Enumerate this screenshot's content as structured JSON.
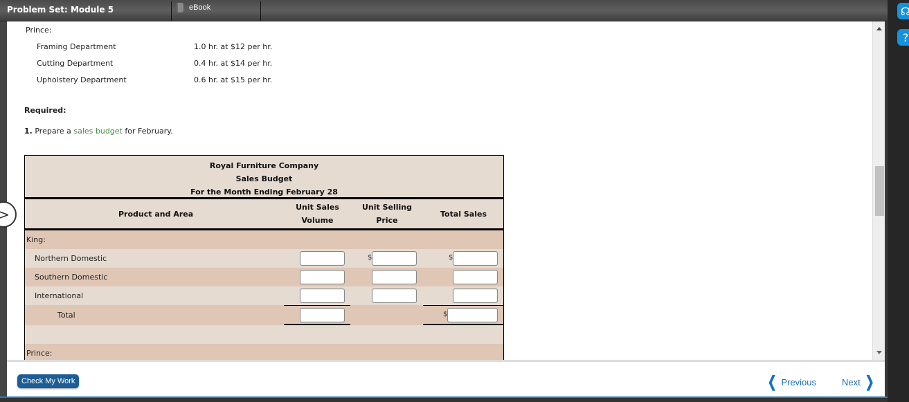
{
  "window": {
    "title": "Problem Set: Module 5",
    "tabs": [
      {
        "label": "eBook",
        "icon": "book-icon"
      }
    ]
  },
  "problem": {
    "prince_label": "Prince:",
    "departments": [
      {
        "name": "Framing Department",
        "rate": "1.0 hr. at $12 per hr."
      },
      {
        "name": "Cutting Department",
        "rate": "0.4 hr. at $14 per hr."
      },
      {
        "name": "Upholstery Department",
        "rate": "0.6 hr. at $15 per hr."
      }
    ],
    "required_label": "Required:",
    "instruction": {
      "number": "1.",
      "prefix": "Prepare a",
      "link": "sales budget",
      "suffix": "for February."
    }
  },
  "budget": {
    "company": "Royal Furniture Company",
    "title": "Sales Budget",
    "period": "For the Month Ending February 28",
    "columns": {
      "product": "Product and Area",
      "volume_line1": "Unit Sales",
      "volume_line2": "Volume",
      "price_line1": "Unit Selling",
      "price_line2": "Price",
      "total": "Total Sales"
    },
    "currency_symbol": "$",
    "sections": [
      {
        "label": "King:",
        "rows": [
          {
            "label": "Northern Domestic",
            "volume": "",
            "price": "",
            "total": ""
          },
          {
            "label": "Southern Domestic",
            "volume": "",
            "price": "",
            "total": ""
          },
          {
            "label": "International",
            "volume": "",
            "price": "",
            "total": ""
          }
        ],
        "total_label": "Total",
        "total_volume": "",
        "total_sales": ""
      },
      {
        "label": "Prince:"
      }
    ]
  },
  "footer": {
    "check_button": "Check My Work",
    "previous": "Previous",
    "next": "Next"
  },
  "colors": {
    "accent": "#1c5d96",
    "link_green": "#4a8a4a",
    "row_dark": "#dfc6b5",
    "row_light": "#e5dbd1"
  }
}
